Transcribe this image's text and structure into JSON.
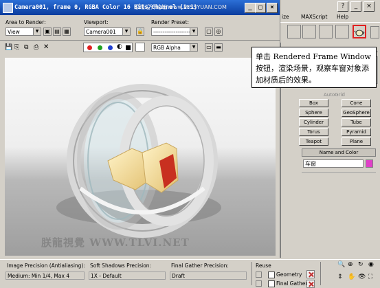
{
  "window": {
    "title": "Camera001, frame 0, RGBA Color 16 Bits/Channel (1:1)",
    "overlay_text": "思缘设计论坛 www.MISSYUAN.COM"
  },
  "controls": {
    "area_label": "Area to Render:",
    "area_value": "View",
    "viewport_label": "Viewport:",
    "viewport_value": "Camera001",
    "preset_label": "Render Preset:",
    "preset_value": "--------------------",
    "channel_value": "RGB Alpha"
  },
  "channel_colors": {
    "red": "#e02020",
    "green": "#20a020",
    "blue": "#2040d0"
  },
  "watermark": "朕龍視覺 WWW.TLVI.NET",
  "bottom": {
    "image_precision_label": "Image Precision (Antialiasing):",
    "image_precision_value": "Medium: Min 1/4, Max 4",
    "shadows_label": "Soft Shadows Precision:",
    "shadows_value": "1X - Default",
    "final_gather_label": "Final Gather Precision:",
    "final_gather_value": "Draft",
    "reuse_label": "Reuse",
    "geometry_label": "Geometry",
    "final_gather_check_label": "Final Gather"
  },
  "max_menu": {
    "item1": "ize",
    "item2": "MAXScript",
    "item3": "Help"
  },
  "command_panel": {
    "autogrid_label": "AutoGrid",
    "objects": [
      "Box",
      "Cone",
      "Sphere",
      "GeoSphere",
      "Cylinder",
      "Tube",
      "Torus",
      "Pyramid",
      "Teapot",
      "Plane"
    ],
    "name_color_label": "Name and Color",
    "name_value": "车窗",
    "object_color": "#e040c8"
  },
  "callout": {
    "text": "单击 Rendered Frame Window 按钮，渲染场景，观察车窗对象添加材质后的效果。"
  },
  "highlight_color": "#e02020"
}
